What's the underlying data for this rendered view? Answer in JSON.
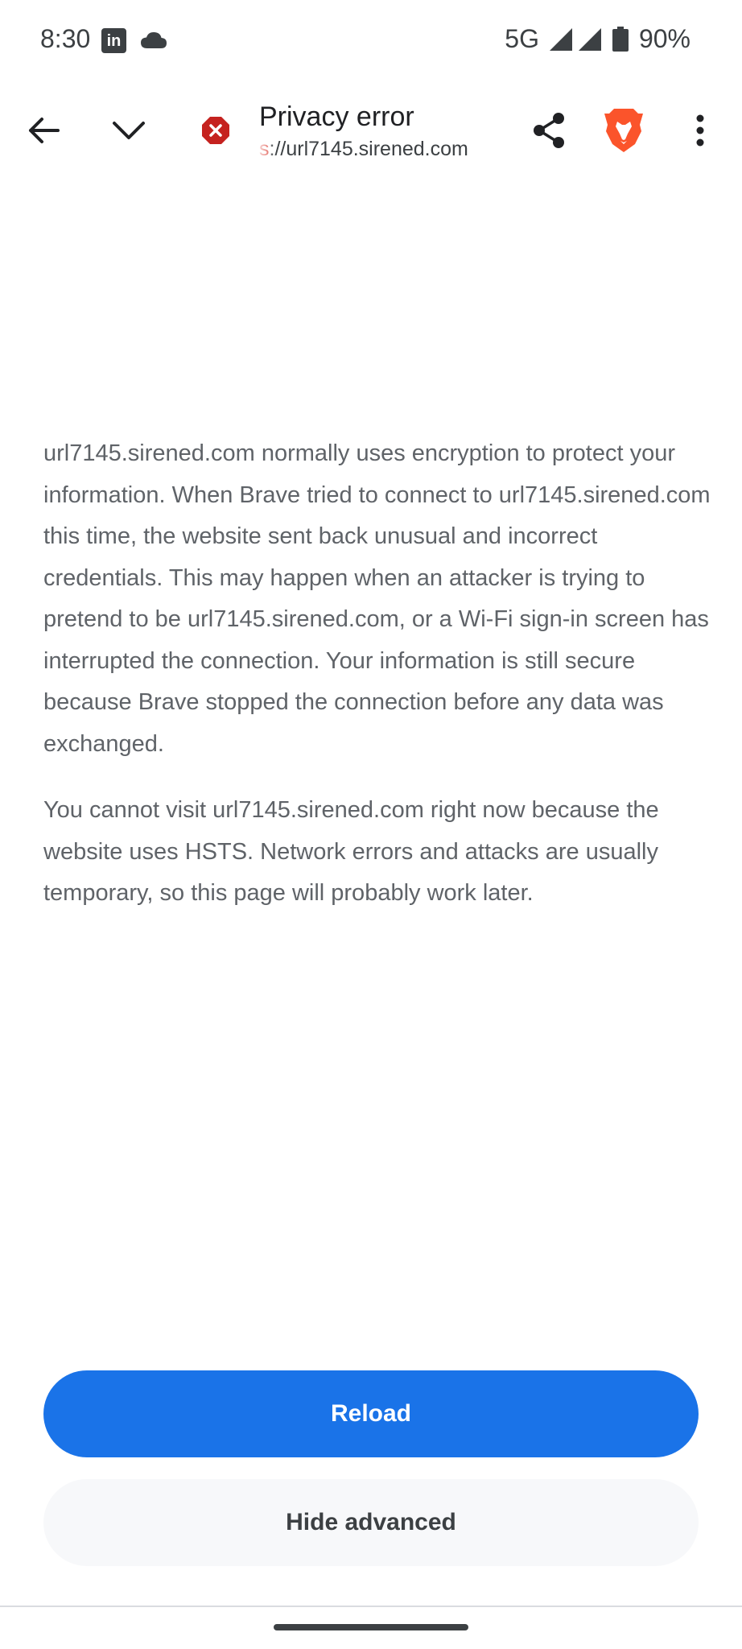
{
  "status_bar": {
    "time": "8:30",
    "notification_icons": [
      "linkedin-icon",
      "cloud-icon"
    ],
    "network": "5G",
    "battery_percent": "90%",
    "battery_level": 0.9
  },
  "toolbar": {
    "title": "Privacy error",
    "url_scheme": "s",
    "url_rest": "://url7145.sirened.com",
    "icons": [
      "back-arrow-icon",
      "chevron-down-icon",
      "security-error-icon",
      "share-icon",
      "brave-lion-icon",
      "more-vert-icon"
    ]
  },
  "content": {
    "paragraph_1": "url7145.sirened.com normally uses encryption to protect your information. When Brave tried to connect to url7145.sirened.com this time, the website sent back unusual and incorrect credentials. This may happen when an attacker is trying to pretend to be url7145.sirened.com, or a Wi-Fi sign-in screen has interrupted the connection. Your information is still secure because Brave stopped the connection before any data was exchanged.",
    "paragraph_2": "You cannot visit url7145.sirened.com right now because the website uses HSTS. Network errors and attacks are usually temporary, so this page will probably work later."
  },
  "actions": {
    "reload_label": "Reload",
    "hide_advanced_label": "Hide advanced"
  },
  "colors": {
    "primary_blue": "#1a73e8",
    "error_red": "#c5221f",
    "brave_orange": "#fb542b",
    "body_text": "#5f6368"
  }
}
